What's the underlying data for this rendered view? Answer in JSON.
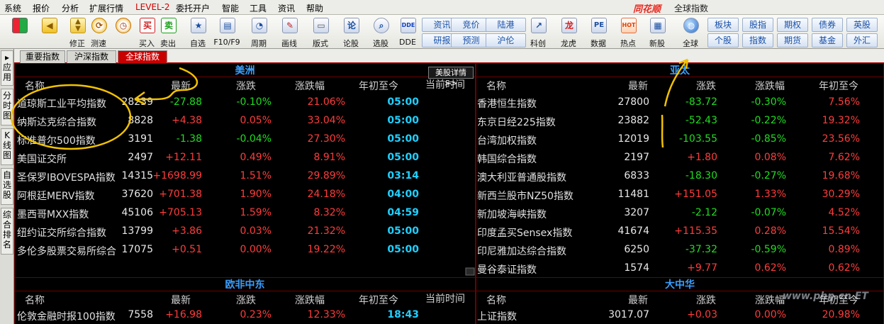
{
  "menubar": {
    "items": [
      "系统",
      "报价",
      "分析",
      "扩展行情",
      "LEVEL-2",
      "委托开户",
      "智能",
      "工具",
      "资讯",
      "帮助"
    ],
    "brand": "同花顺",
    "window_title": "全球指数"
  },
  "toolbar": {
    "buttons": [
      {
        "label": "",
        "icon": "window-layout-icon"
      },
      {
        "label": "",
        "icon": "back-arrow-icon"
      },
      {
        "label": "修正",
        "icon": "up-down-icon"
      },
      {
        "label": "测速",
        "icon": "speed-icon"
      },
      {
        "label": "买入",
        "icon": "buy-icon",
        "glyph": "买"
      },
      {
        "label": "卖出",
        "icon": "sell-icon",
        "glyph": "卖"
      },
      {
        "label": "自选",
        "icon": "star-icon"
      },
      {
        "label": "F10/F9",
        "icon": "f10-icon"
      },
      {
        "label": "周期",
        "icon": "clock-icon"
      },
      {
        "label": "画线",
        "icon": "pen-icon"
      },
      {
        "label": "版式",
        "icon": "monitor-icon"
      },
      {
        "label": "论股",
        "icon": "discuss-icon"
      },
      {
        "label": "选股",
        "icon": "search-icon"
      },
      {
        "label": "DDE",
        "icon": "dde-icon",
        "glyph": "DDE"
      },
      {
        "label": "科创",
        "icon": "kechuang-icon"
      },
      {
        "label": "龙虎",
        "icon": "dragon-icon"
      },
      {
        "label": "数据",
        "icon": "pe-icon",
        "glyph": "PE"
      },
      {
        "label": "热点",
        "icon": "hot-icon",
        "glyph": "HOT"
      },
      {
        "label": "新股",
        "icon": "new-stock-icon"
      },
      {
        "label": "全球",
        "icon": "globe-icon"
      }
    ],
    "quick": [
      {
        "label": "资讯"
      },
      {
        "label": "研报"
      },
      {
        "label": "竞价"
      },
      {
        "label": "预测"
      },
      {
        "label": "陆港"
      },
      {
        "label": "沪伦"
      },
      {
        "label": "板块"
      },
      {
        "label": "个股"
      },
      {
        "label": "股指"
      },
      {
        "label": "指数"
      },
      {
        "label": "期权"
      },
      {
        "label": "期货"
      },
      {
        "label": "债券"
      },
      {
        "label": "基金"
      },
      {
        "label": "英股"
      },
      {
        "label": "外汇"
      }
    ]
  },
  "side_tabs": [
    "应用",
    "分时图",
    "K线图",
    "自选股",
    "综合排名"
  ],
  "top_tabs": [
    "重要指数",
    "沪深指数",
    "全球指数"
  ],
  "us_detail_button": "美股详情>>",
  "columns": {
    "name": "名称",
    "latest": "最新",
    "change": "涨跌",
    "change_pct": "涨跌幅",
    "ytd": "年初至今",
    "time": "当前时间"
  },
  "panels": {
    "americas": {
      "title": "美洲",
      "rows": [
        {
          "name": "道琼斯工业平均指数",
          "latest": "28239",
          "change": "-27.88",
          "change_pct": "-0.10%",
          "ytd": "21.06%",
          "time": "05:00"
        },
        {
          "name": "纳斯达克综合指数",
          "latest": "8828",
          "change": "+4.38",
          "change_pct": "0.05%",
          "ytd": "33.04%",
          "time": "05:00"
        },
        {
          "name": "标准普尔500指数",
          "latest": "3191",
          "change": "-1.38",
          "change_pct": "-0.04%",
          "ytd": "27.30%",
          "time": "05:00"
        },
        {
          "name": "美国证交所",
          "latest": "2497",
          "change": "+12.11",
          "change_pct": "0.49%",
          "ytd": "8.91%",
          "time": "05:00"
        },
        {
          "name": "圣保罗IBOVESPA指数",
          "latest": "14315",
          "change": "+1698.99",
          "change_pct": "1.51%",
          "ytd": "29.89%",
          "time": "03:14"
        },
        {
          "name": "阿根廷MERV指数",
          "latest": "37620",
          "change": "+701.38",
          "change_pct": "1.90%",
          "ytd": "24.18%",
          "time": "04:00"
        },
        {
          "name": "墨西哥MXX指数",
          "latest": "45106",
          "change": "+705.13",
          "change_pct": "1.59%",
          "ytd": "8.32%",
          "time": "04:59"
        },
        {
          "name": "纽约证交所综合指数",
          "latest": "13799",
          "change": "+3.86",
          "change_pct": "0.03%",
          "ytd": "21.32%",
          "time": "05:00"
        },
        {
          "name": "多伦多股票交易所综合",
          "latest": "17075",
          "change": "+0.51",
          "change_pct": "0.00%",
          "ytd": "19.22%",
          "time": "05:00"
        }
      ]
    },
    "asia_pacific": {
      "title": "亚太",
      "rows": [
        {
          "name": "香港恒生指数",
          "latest": "27800",
          "change": "-83.72",
          "change_pct": "-0.30%",
          "ytd": "7.56%"
        },
        {
          "name": "东京日经225指数",
          "latest": "23882",
          "change": "-52.43",
          "change_pct": "-0.22%",
          "ytd": "19.32%"
        },
        {
          "name": "台湾加权指数",
          "latest": "12019",
          "change": "-103.55",
          "change_pct": "-0.85%",
          "ytd": "23.56%"
        },
        {
          "name": "韩国综合指数",
          "latest": "2197",
          "change": "+1.80",
          "change_pct": "0.08%",
          "ytd": "7.62%"
        },
        {
          "name": "澳大利亚普通股指数",
          "latest": "6833",
          "change": "-18.30",
          "change_pct": "-0.27%",
          "ytd": "19.68%"
        },
        {
          "name": "新西兰股市NZ50指数",
          "latest": "11481",
          "change": "+151.05",
          "change_pct": "1.33%",
          "ytd": "30.29%"
        },
        {
          "name": "新加坡海峡指数",
          "latest": "3207",
          "change": "-2.12",
          "change_pct": "-0.07%",
          "ytd": "4.52%"
        },
        {
          "name": "印度孟买Sensex指数",
          "latest": "41674",
          "change": "+115.35",
          "change_pct": "0.28%",
          "ytd": "15.54%"
        },
        {
          "name": "印尼雅加达综合指数",
          "latest": "6250",
          "change": "-37.32",
          "change_pct": "-0.59%",
          "ytd": "0.89%"
        },
        {
          "name": "曼谷泰证指数",
          "latest": "1574",
          "change": "+9.77",
          "change_pct": "0.62%",
          "ytd": "0.62%"
        }
      ]
    },
    "europe_africa_me": {
      "title": "欧非中东",
      "rows": [
        {
          "name": "伦敦金融时报100指数",
          "latest": "7558",
          "change": "+16.98",
          "change_pct": "0.23%",
          "ytd": "12.33%",
          "time": "18:43"
        }
      ]
    },
    "greater_china": {
      "title": "大中华",
      "rows": [
        {
          "name": "上证指数",
          "latest": "3017.07",
          "change": "+0.03",
          "change_pct": "0.00%",
          "ytd": "20.98%"
        }
      ]
    }
  },
  "watermark": "www.php.cn ET",
  "annotation_color": "#f2c200"
}
